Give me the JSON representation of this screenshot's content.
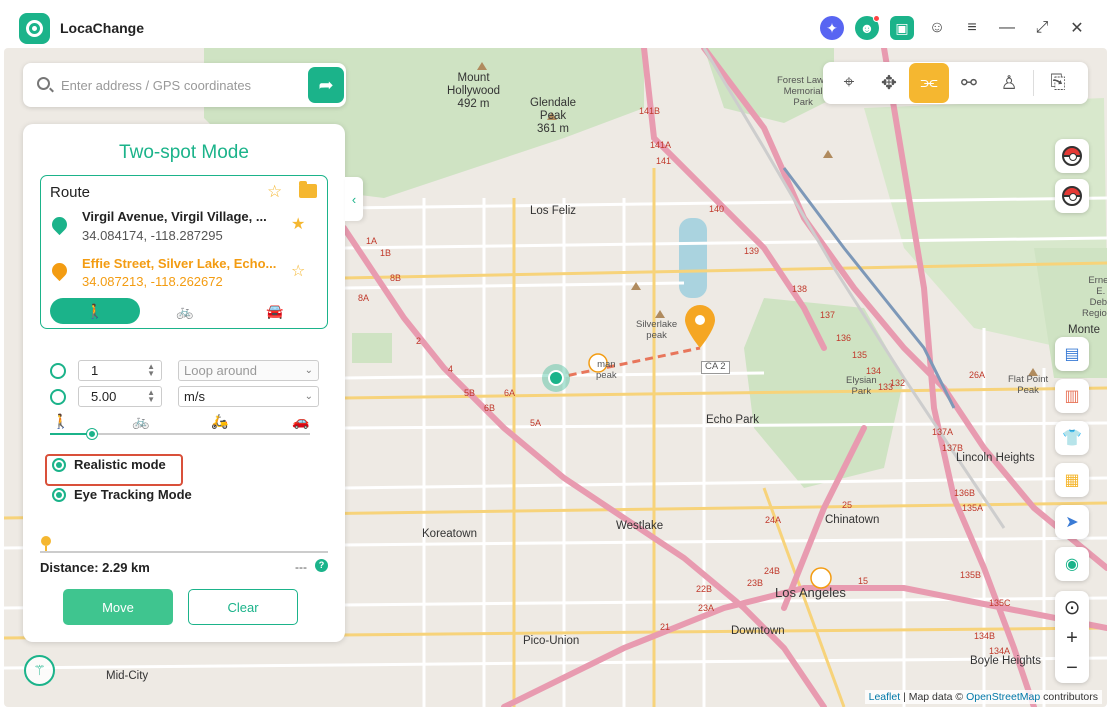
{
  "app": {
    "title": "LocaChange"
  },
  "titlebar": {
    "icons": [
      "discord-icon",
      "user-icon",
      "bag-icon",
      "chat-icon",
      "menu-icon",
      "minimize-icon",
      "expand-icon",
      "close-icon"
    ],
    "glyphs": {
      "discord": "✦",
      "user": "☻",
      "bag": "▣",
      "chat": "☺",
      "menu": "≡",
      "minimize": "—",
      "expand": "⤢",
      "close": "✕"
    }
  },
  "search": {
    "placeholder": "Enter address / GPS coordinates",
    "go_glyph": "➦"
  },
  "modebar": {
    "buttons": [
      {
        "name": "teleport-mode",
        "glyph": "⌖"
      },
      {
        "name": "joystick-mode",
        "glyph": "✥"
      },
      {
        "name": "two-spot-mode",
        "glyph": "⫘"
      },
      {
        "name": "multi-spot-mode",
        "glyph": "⚯"
      },
      {
        "name": "profile-mode",
        "glyph": "♙"
      },
      {
        "name": "history",
        "glyph": "⎘"
      }
    ],
    "active": "two-spot-mode"
  },
  "panel": {
    "title": "Two-spot Mode",
    "collapse_glyph": "‹",
    "route": {
      "heading": "Route",
      "start": {
        "name": "Virgil Avenue, Virgil Village, ...",
        "coords": "34.084174, -118.287295",
        "fav_glyph": "★"
      },
      "end": {
        "name": "Effie Street, Silver Lake, Echo...",
        "coords": "34.087213, -118.262672",
        "fav_glyph": "☆"
      },
      "header_star": "☆",
      "transport": [
        {
          "name": "walk",
          "glyph": "🚶"
        },
        {
          "name": "bike",
          "glyph": "🚲"
        },
        {
          "name": "car",
          "glyph": "🚘"
        }
      ],
      "transport_active": "walk"
    },
    "settings": {
      "loops": "1",
      "loop_mode": "Loop around",
      "speed": "5.00",
      "speed_unit": "m/s",
      "speed_level": 0.16,
      "speed_icons": [
        "🚶",
        "🚲",
        "🛵",
        "🚗"
      ],
      "realistic_mode": "Realistic mode",
      "eye_tracking": "Eye Tracking Mode"
    },
    "distance": {
      "label": "Distance: 2.29 km",
      "right": "---",
      "help": "?"
    },
    "move": "Move",
    "clear": "Clear"
  },
  "map": {
    "labels": [
      {
        "text": "Mount\nHollywood\n492 m"
      },
      {
        "text": "Glendale\nPeak\n361 m"
      },
      {
        "text": "Forest Lawn\nMemorial\nPark"
      },
      {
        "text": "Los Feliz"
      },
      {
        "text": "Silverlake\npeak"
      },
      {
        "text": "man\npeak"
      },
      {
        "text": "Echo Park"
      },
      {
        "text": "Elysian\nPark"
      },
      {
        "text": "Flat Point\nPeak"
      },
      {
        "text": "Lincoln Heights"
      },
      {
        "text": "Chinatown"
      },
      {
        "text": "Westlake"
      },
      {
        "text": "Koreatown"
      },
      {
        "text": "Los Angeles"
      },
      {
        "text": "Downtown"
      },
      {
        "text": "Pico-Union"
      },
      {
        "text": "Mid-City"
      },
      {
        "text": "Boyle Heights"
      },
      {
        "text": "Monte"
      },
      {
        "text": "Ernes\nE.\nDebs\nRegional"
      },
      {
        "text": "CA 2"
      }
    ],
    "highways": [
      "141B",
      "141A",
      "141",
      "140",
      "139",
      "138",
      "137",
      "136",
      "135",
      "134",
      "133",
      "132",
      "137A",
      "137B",
      "136B",
      "135A",
      "135B",
      "135C",
      "134B",
      "134A",
      "26A",
      "25",
      "24B",
      "2",
      "4",
      "5B",
      "6A",
      "6B",
      "8B",
      "8A",
      "1A",
      "1B",
      "5A",
      "24A",
      "23A",
      "23B",
      "22B",
      "21",
      "15"
    ]
  },
  "right_tools": {
    "glyphs": [
      "▤",
      "▥",
      "👕",
      "▦",
      "➤",
      "◉"
    ],
    "zoom_locate": "⊙",
    "zoom_in": "+",
    "zoom_out": "−"
  },
  "footer": {
    "leaflet": "Leaflet",
    "attrib_mid": " | Map data © ",
    "osm": "OpenStreetMap",
    "attrib_end": " contributors",
    "bottom_logo_glyph": "⚚"
  },
  "colors": {
    "accent": "#1bb38a",
    "active_mode": "#f5b730",
    "highway": "#e89bb0",
    "route_line": "#e8765b"
  }
}
